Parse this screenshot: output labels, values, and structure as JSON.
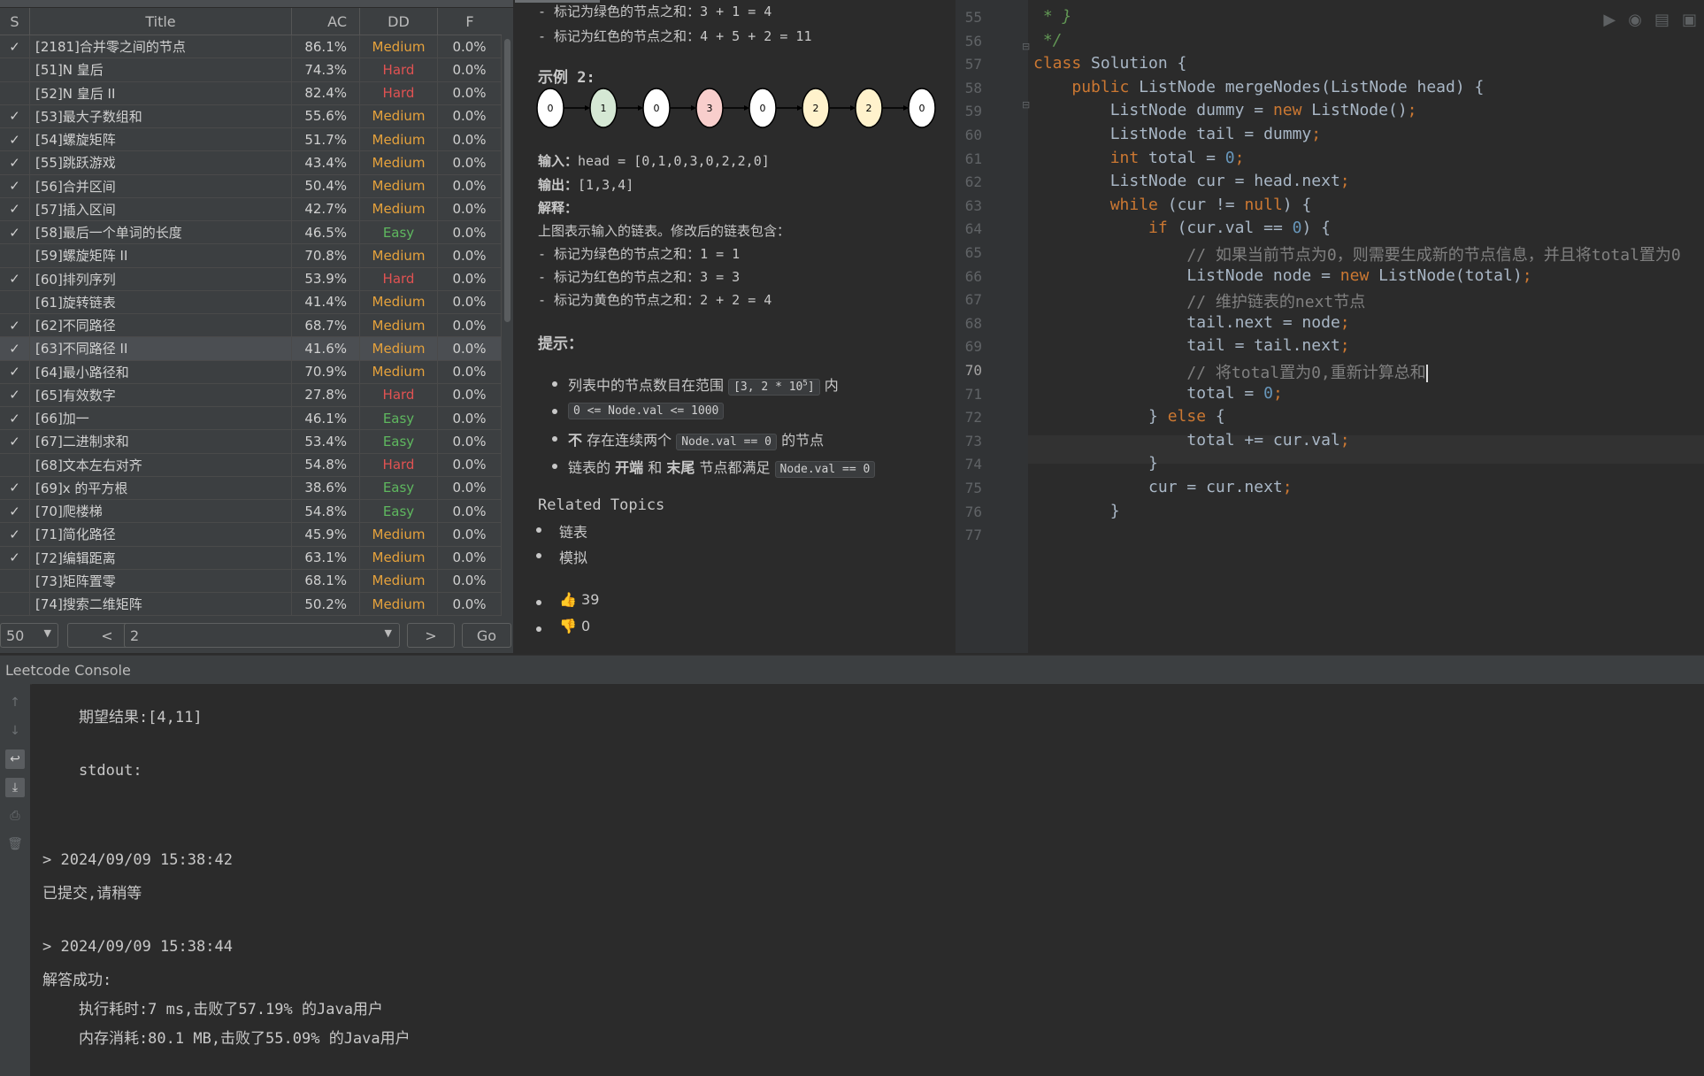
{
  "table": {
    "headers": {
      "s": "S",
      "title": "Title",
      "ac": "AC",
      "dd": "DD",
      "f": "F"
    },
    "rows": [
      {
        "s": "✓",
        "title": "[2181]合并零之间的节点",
        "ac": "86.1%",
        "dd": "Medium",
        "f": "0.0%"
      },
      {
        "s": "",
        "title": "[51]N 皇后",
        "ac": "74.3%",
        "dd": "Hard",
        "f": "0.0%"
      },
      {
        "s": "",
        "title": "[52]N 皇后 II",
        "ac": "82.4%",
        "dd": "Hard",
        "f": "0.0%"
      },
      {
        "s": "✓",
        "title": "[53]最大子数组和",
        "ac": "55.6%",
        "dd": "Medium",
        "f": "0.0%"
      },
      {
        "s": "✓",
        "title": "[54]螺旋矩阵",
        "ac": "51.7%",
        "dd": "Medium",
        "f": "0.0%"
      },
      {
        "s": "✓",
        "title": "[55]跳跃游戏",
        "ac": "43.4%",
        "dd": "Medium",
        "f": "0.0%"
      },
      {
        "s": "✓",
        "title": "[56]合并区间",
        "ac": "50.4%",
        "dd": "Medium",
        "f": "0.0%"
      },
      {
        "s": "✓",
        "title": "[57]插入区间",
        "ac": "42.7%",
        "dd": "Medium",
        "f": "0.0%"
      },
      {
        "s": "✓",
        "title": "[58]最后一个单词的长度",
        "ac": "46.5%",
        "dd": "Easy",
        "f": "0.0%"
      },
      {
        "s": "",
        "title": "[59]螺旋矩阵 II",
        "ac": "70.8%",
        "dd": "Medium",
        "f": "0.0%"
      },
      {
        "s": "✓",
        "title": "[60]排列序列",
        "ac": "53.9%",
        "dd": "Hard",
        "f": "0.0%"
      },
      {
        "s": "",
        "title": "[61]旋转链表",
        "ac": "41.4%",
        "dd": "Medium",
        "f": "0.0%"
      },
      {
        "s": "✓",
        "title": "[62]不同路径",
        "ac": "68.7%",
        "dd": "Medium",
        "f": "0.0%"
      },
      {
        "s": "✓",
        "title": "[63]不同路径 II",
        "ac": "41.6%",
        "dd": "Medium",
        "f": "0.0%"
      },
      {
        "s": "✓",
        "title": "[64]最小路径和",
        "ac": "70.9%",
        "dd": "Medium",
        "f": "0.0%"
      },
      {
        "s": "✓",
        "title": "[65]有效数字",
        "ac": "27.8%",
        "dd": "Hard",
        "f": "0.0%"
      },
      {
        "s": "✓",
        "title": "[66]加一",
        "ac": "46.1%",
        "dd": "Easy",
        "f": "0.0%"
      },
      {
        "s": "✓",
        "title": "[67]二进制求和",
        "ac": "53.4%",
        "dd": "Easy",
        "f": "0.0%"
      },
      {
        "s": "",
        "title": "[68]文本左右对齐",
        "ac": "54.8%",
        "dd": "Hard",
        "f": "0.0%"
      },
      {
        "s": "✓",
        "title": "[69]x 的平方根",
        "ac": "38.6%",
        "dd": "Easy",
        "f": "0.0%"
      },
      {
        "s": "✓",
        "title": "[70]爬楼梯",
        "ac": "54.8%",
        "dd": "Easy",
        "f": "0.0%"
      },
      {
        "s": "✓",
        "title": "[71]简化路径",
        "ac": "45.9%",
        "dd": "Medium",
        "f": "0.0%"
      },
      {
        "s": "✓",
        "title": "[72]编辑距离",
        "ac": "63.1%",
        "dd": "Medium",
        "f": "0.0%"
      },
      {
        "s": "",
        "title": "[73]矩阵置零",
        "ac": "68.1%",
        "dd": "Medium",
        "f": "0.0%"
      },
      {
        "s": "",
        "title": "[74]搜索二维矩阵",
        "ac": "50.2%",
        "dd": "Medium",
        "f": "0.0%"
      }
    ],
    "selected_row": 13
  },
  "pager": {
    "page_size": "50",
    "prev": "<",
    "page": "2",
    "next": ">",
    "go": "Go"
  },
  "description": {
    "top_line": "- 标记为绿色的节点之和：3 + 1 = 4",
    "red_line": "- 标记为红色的节点之和：4 + 5 + 2 = 11",
    "example_title": "示例 2:",
    "nodes": [
      {
        "v": "0",
        "color": "#ffffff"
      },
      {
        "v": "1",
        "color": "#d5e8d4"
      },
      {
        "v": "0",
        "color": "#ffffff"
      },
      {
        "v": "3",
        "color": "#f8cecc"
      },
      {
        "v": "0",
        "color": "#ffffff"
      },
      {
        "v": "2",
        "color": "#fff2cc"
      },
      {
        "v": "2",
        "color": "#fff2cc"
      },
      {
        "v": "0",
        "color": "#ffffff"
      }
    ],
    "input_label": "输入：",
    "input_value": "head = [0,1,0,3,0,2,2,0]",
    "output_label": "输出：",
    "output_value": "[1,3,4]",
    "explain_label": "解释：",
    "explain_lines": [
      "上图表示输入的链表。修改后的链表包含：",
      "- 标记为绿色的节点之和：1 = 1",
      "- 标记为红色的节点之和：3 = 3",
      "- 标记为黄色的节点之和：2 + 2 = 4"
    ],
    "hints_title": "提示：",
    "hint1_text": "列表中的节点数目在范围",
    "hint1_code": "[3, 2 * 10",
    "hint1_sup": "5",
    "hint1_code_end": "]",
    "hint1_tail": "内",
    "hint2_code": "0 <= Node.val <= 1000",
    "hint3_bold": "不",
    "hint3_text": "存在连续两个",
    "hint3_code": "Node.val == 0",
    "hint3_tail": "的节点",
    "hint4_text": "链表的",
    "hint4_bold1": "开端",
    "hint4_and": "和",
    "hint4_bold2": "末尾",
    "hint4_tail": "节点都满足",
    "hint4_code": "Node.val == 0",
    "related_title": "Related Topics",
    "topics": [
      "链表",
      "模拟"
    ],
    "likes": "39",
    "dislikes": "0"
  },
  "editor": {
    "current_line": "70",
    "lines": [
      {
        "n": "55",
        "html": "<span class=\"fcm\"> * }</span>"
      },
      {
        "n": "56",
        "html": "<span class=\"fcm\"> */</span>"
      },
      {
        "n": "57",
        "html": "<span class=\"kw\">class</span> Solution {"
      },
      {
        "n": "58",
        "html": "    <span class=\"kw\">public</span> ListNode mergeNodes(ListNode head) {"
      },
      {
        "n": "59",
        "html": "        ListNode dummy = <span class=\"kw\">new</span> ListNode()<span class=\"kw\">;</span>"
      },
      {
        "n": "60",
        "html": "        ListNode tail = dummy<span class=\"kw\">;</span>"
      },
      {
        "n": "61",
        "html": "        <span class=\"kw\">int</span> total = <span class=\"num\">0</span><span class=\"kw\">;</span>"
      },
      {
        "n": "62",
        "html": "        ListNode cur = head.next<span class=\"kw\">;</span>"
      },
      {
        "n": "63",
        "html": "        <span class=\"kw\">while</span> (cur != <span class=\"kw\">null</span>) {"
      },
      {
        "n": "64",
        "html": "            <span class=\"kw\">if</span> (cur.val == <span class=\"num\">0</span>) {"
      },
      {
        "n": "65",
        "html": "                <span class=\"cm\">// 如果当前节点为0，则需要生成新的节点信息，并且将total置为0</span>"
      },
      {
        "n": "66",
        "html": "                ListNode node = <span class=\"kw\">new</span> ListNode(total)<span class=\"kw\">;</span>"
      },
      {
        "n": "67",
        "html": "                <span class=\"cm\">// 维护链表的next节点</span>"
      },
      {
        "n": "68",
        "html": "                tail.next = node<span class=\"kw\">;</span>"
      },
      {
        "n": "69",
        "html": "                tail = tail.next<span class=\"kw\">;</span>"
      },
      {
        "n": "70",
        "html": "                <span class=\"cm\">// 将total置为0,重新计算总和</span>"
      },
      {
        "n": "71",
        "html": "                total = <span class=\"num\">0</span><span class=\"kw\">;</span>"
      },
      {
        "n": "72",
        "html": "            } <span class=\"kw\">else</span> {"
      },
      {
        "n": "73",
        "html": "                total += cur.val<span class=\"kw\">;</span>"
      },
      {
        "n": "74",
        "html": "            }"
      },
      {
        "n": "75",
        "html": "            cur = cur.next<span class=\"kw\">;</span>"
      },
      {
        "n": "76",
        "html": "        }"
      },
      {
        "n": "77",
        "html": ""
      }
    ]
  },
  "console": {
    "title": "Leetcode Console",
    "lines": [
      "    期望结果:[4,11]",
      "    stdout:",
      "> 2024/09/09 15:38:42",
      "已提交,请稍等",
      "> 2024/09/09 15:38:44",
      "解答成功:",
      "    执行耗时:7 ms,击败了57.19% 的Java用户",
      "    内存消耗:80.1 MB,击败了55.09% 的Java用户"
    ]
  }
}
